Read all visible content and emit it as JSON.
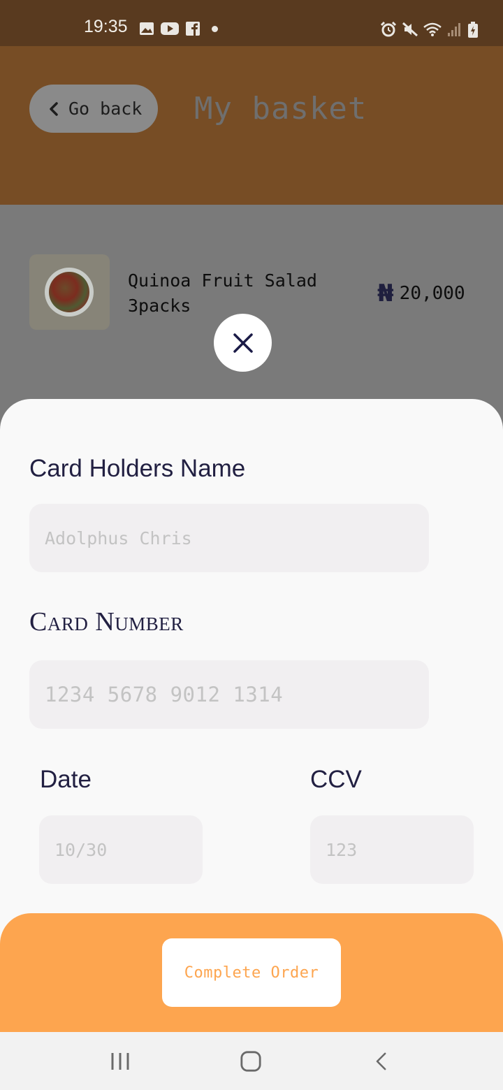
{
  "status_bar": {
    "time": "19:35",
    "left_icons": [
      "gallery-icon",
      "youtube-icon",
      "facebook-icon",
      "dot-icon"
    ],
    "right_icons": [
      "alarm-icon",
      "mute-icon",
      "wifi-icon",
      "signal-icon",
      "battery-charging-icon"
    ]
  },
  "header": {
    "back_label": "Go back",
    "title": "My basket",
    "background": "#774d25"
  },
  "basket": {
    "items": [
      {
        "name": "Quinoa Fruit Salad",
        "quantity": "3packs",
        "currency_symbol": "₦",
        "price": "20,000"
      }
    ]
  },
  "payment_form": {
    "card_holder": {
      "label": "Card Holders Name",
      "placeholder": "Adolphus Chris",
      "value": ""
    },
    "card_number": {
      "label": "Card Number",
      "placeholder": "1234 5678 9012 1314",
      "value": ""
    },
    "date": {
      "label": "Date",
      "placeholder": "10/30",
      "value": ""
    },
    "ccv": {
      "label": "CCV",
      "placeholder": "123",
      "value": ""
    }
  },
  "footer": {
    "button_label": "Complete Order",
    "background": "#fda54f"
  },
  "colors": {
    "accent_orange": "#fda54f",
    "label_navy": "#222042"
  }
}
